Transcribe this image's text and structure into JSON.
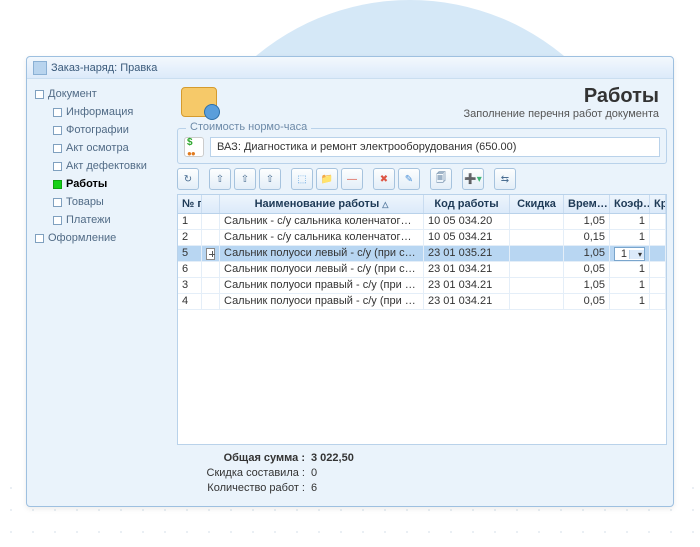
{
  "window": {
    "title": "Заказ-наряд: Правка"
  },
  "sidebar": {
    "items": [
      {
        "label": "Документ",
        "child": false
      },
      {
        "label": "Информация",
        "child": true
      },
      {
        "label": "Фотографии",
        "child": true
      },
      {
        "label": "Акт осмотра",
        "child": true
      },
      {
        "label": "Акт дефектовки",
        "child": true
      },
      {
        "label": "Работы",
        "child": true,
        "active": true
      },
      {
        "label": "Товары",
        "child": true
      },
      {
        "label": "Платежи",
        "child": true
      },
      {
        "label": "Оформление",
        "child": false
      }
    ]
  },
  "header": {
    "title": "Работы",
    "subtitle": "Заполнение перечня работ документа"
  },
  "cost": {
    "legend": "Стоимость нормо-часа",
    "value": "ВАЗ: Диагностика и ремонт электрооборудования (650.00)"
  },
  "toolbar": [
    "↻",
    "⇧",
    "⇧",
    "⇧",
    "⬚",
    "📁",
    "—",
    "✖",
    "✎",
    "🗐",
    "➕▾",
    "⇆"
  ],
  "grid": {
    "cols": {
      "row": "№ п/п",
      "name": "Наименование работы",
      "code": "Код работы",
      "disc": "Скидка",
      "time": "Врем…",
      "coef": "Коэф…",
      "last": "Кр"
    },
    "rows": [
      {
        "n": "1",
        "name": "Сальник - с/у сальника коленчатог…",
        "code": "10 05 034.20",
        "disc": "",
        "time": "1,05",
        "coef": "1"
      },
      {
        "n": "2",
        "name": "Сальник - с/у сальника коленчатог…",
        "code": "10 05 034.21",
        "disc": "",
        "time": "0,15",
        "coef": "1"
      },
      {
        "n": "5",
        "name": "Сальник полуоси левый - с/у (при с…",
        "code": "23 01 035.21",
        "disc": "",
        "time": "1,05",
        "coef": "1",
        "sel": true,
        "icon": true
      },
      {
        "n": "6",
        "name": "Сальник полуоси левый - с/у (при с…",
        "code": "23 01 034.21",
        "disc": "",
        "time": "0,05",
        "coef": "1"
      },
      {
        "n": "3",
        "name": "Сальник полуоси правый - с/у (при …",
        "code": "23 01 034.21",
        "disc": "",
        "time": "1,05",
        "coef": "1"
      },
      {
        "n": "4",
        "name": "Сальник полуоси правый - с/у (при …",
        "code": "23 01 034.21",
        "disc": "",
        "time": "0,05",
        "coef": "1"
      }
    ]
  },
  "summary": {
    "total_label": "Общая сумма",
    "total_value": "3 022,50",
    "discount_label": "Скидка составила",
    "discount_value": "0",
    "count_label": "Количество работ",
    "count_value": "6"
  }
}
